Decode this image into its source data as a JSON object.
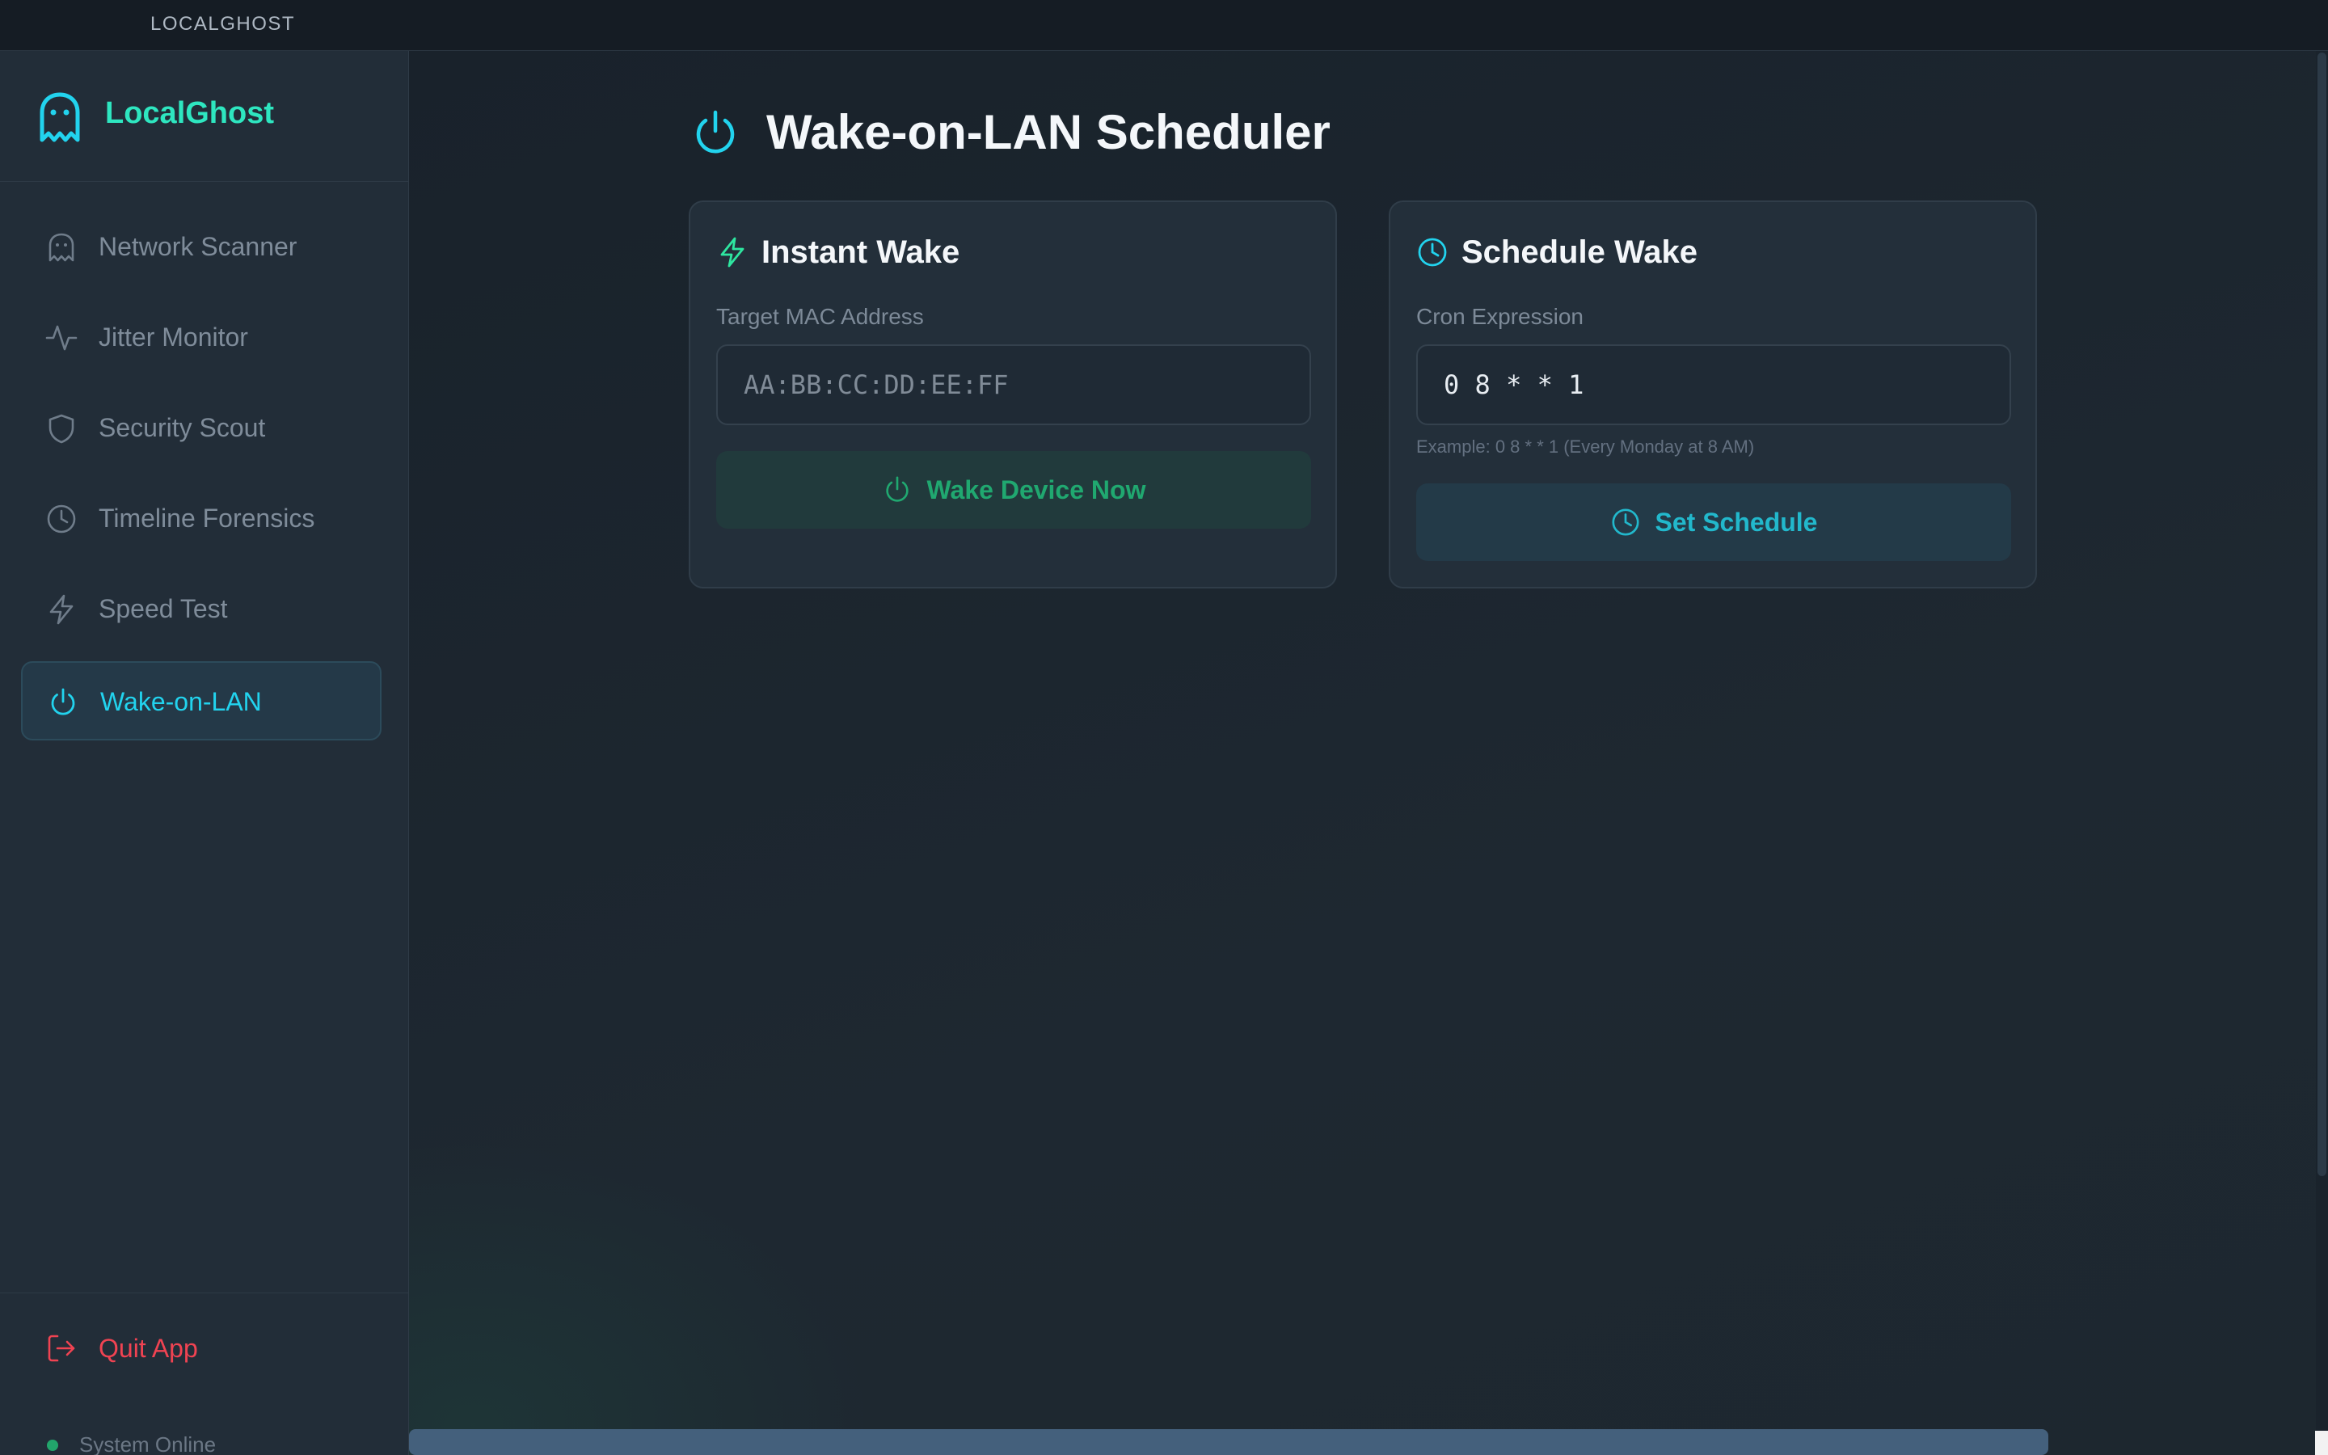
{
  "window": {
    "title": "LOCALGHOST"
  },
  "sidebar": {
    "brand": "LocalGhost",
    "items": [
      {
        "label": "Network Scanner",
        "icon": "ghost-icon"
      },
      {
        "label": "Jitter Monitor",
        "icon": "activity-icon"
      },
      {
        "label": "Security Scout",
        "icon": "shield-icon"
      },
      {
        "label": "Timeline Forensics",
        "icon": "clock-icon"
      },
      {
        "label": "Speed Test",
        "icon": "lightning-icon"
      },
      {
        "label": "Wake-on-LAN",
        "icon": "power-icon",
        "active": true
      }
    ],
    "quit_label": "Quit App",
    "status_label": "System Online"
  },
  "main": {
    "title": "Wake-on-LAN Scheduler",
    "instant": {
      "title": "Instant Wake",
      "field_label": "Target MAC Address",
      "placeholder": "AA:BB:CC:DD:EE:FF",
      "value": "",
      "button_label": "Wake Device Now"
    },
    "schedule": {
      "title": "Schedule Wake",
      "field_label": "Cron Expression",
      "value": "0 8 * * 1",
      "hint": "Example: 0 8 * * 1 (Every Monday at 8 AM)",
      "button_label": "Set Schedule"
    }
  },
  "colors": {
    "accent_cyan": "#22d3ee",
    "accent_green": "#2ee6c0",
    "danger": "#f04352",
    "status_online": "#22a56b"
  }
}
